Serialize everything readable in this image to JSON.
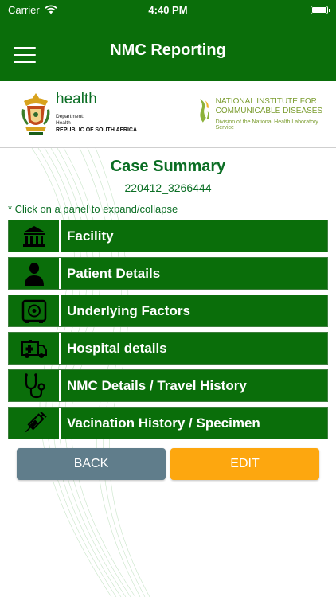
{
  "status_bar": {
    "carrier": "Carrier",
    "time": "4:40 PM"
  },
  "nav": {
    "title": "NMC Reporting"
  },
  "logos": {
    "health": {
      "word": "health",
      "line1": "Department:",
      "line2": "Health",
      "line3": "REPUBLIC OF SOUTH AFRICA"
    },
    "nicd": {
      "line1": "NATIONAL INSTITUTE FOR",
      "line2": "COMMUNICABLE DISEASES",
      "sub": "Division of the National Health Laboratory Service"
    }
  },
  "case": {
    "title": "Case Summary",
    "id": "220412_3266444",
    "hint": "* Click on a panel to expand/collapse"
  },
  "panels": [
    {
      "label": "Facility",
      "icon": "building-icon"
    },
    {
      "label": "Patient Details",
      "icon": "person-icon"
    },
    {
      "label": "Underlying Factors",
      "icon": "safe-icon"
    },
    {
      "label": "Hospital details",
      "icon": "ambulance-icon"
    },
    {
      "label": "NMC Details / Travel History",
      "icon": "stethoscope-icon"
    },
    {
      "label": "Vacination History / Specimen",
      "icon": "syringe-icon"
    }
  ],
  "buttons": {
    "back": "BACK",
    "edit": "EDIT"
  },
  "colors": {
    "primary": "#0a6e0a",
    "back": "#607d8b",
    "edit": "#fda70f"
  }
}
